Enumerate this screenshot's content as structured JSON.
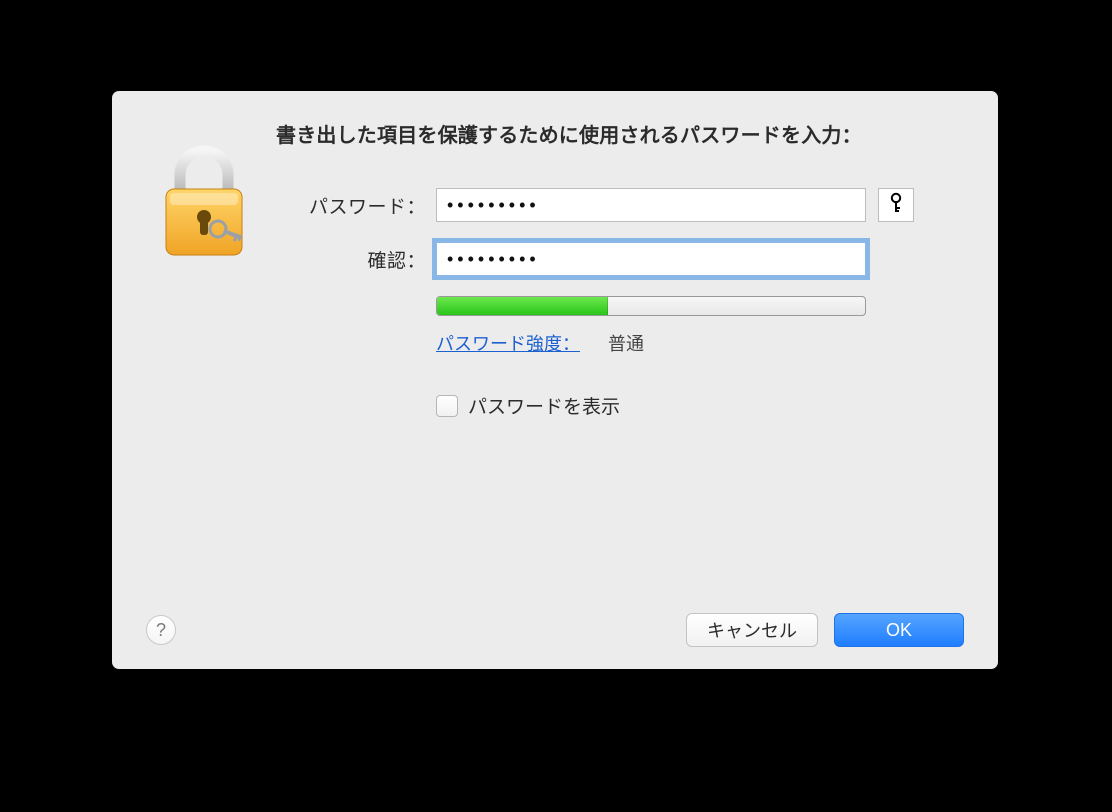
{
  "heading": "書き出した項目を保護するために使用されるパスワードを入力：",
  "form": {
    "password_label": "パスワード：",
    "password_value": "•••••••••",
    "confirm_label": "確認：",
    "confirm_value": "•••••••••"
  },
  "strength": {
    "link_label": "パスワード強度：",
    "value_label": "普通",
    "fill_percent": 40
  },
  "show_password_label": "パスワードを表示",
  "show_password_checked": false,
  "buttons": {
    "cancel": "キャンセル",
    "ok": "OK",
    "help": "?"
  },
  "icons": {
    "lock": "lock-icon",
    "key": "key-icon"
  }
}
